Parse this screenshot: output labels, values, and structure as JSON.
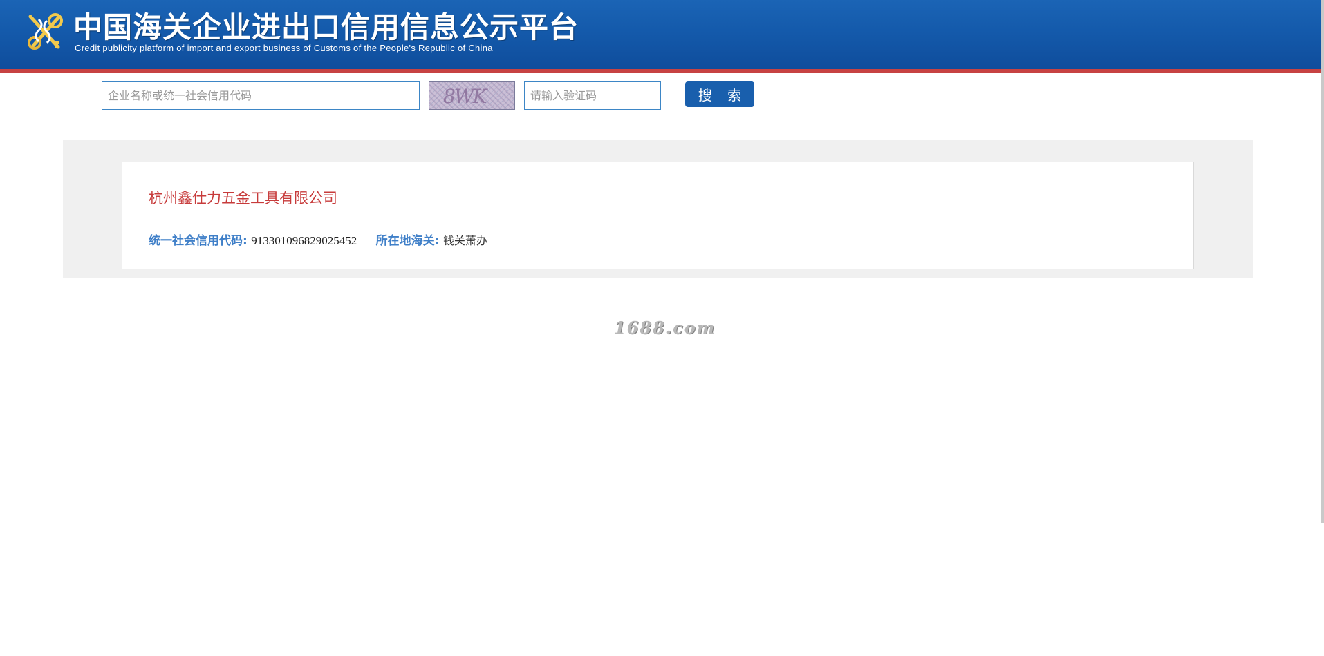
{
  "header": {
    "title_cn": "中国海关企业进出口信用信息公示平台",
    "title_en": "Credit publicity platform of import and export business of Customs of the People's Republic of China",
    "logo_icon": "customs-emblem-icon",
    "brand_color": "#145aab",
    "accent_color": "#c74242"
  },
  "search": {
    "query_placeholder": "企业名称或统一社会信用代码",
    "query_value": "",
    "captcha_text": "8WK",
    "captcha_placeholder": "请输入验证码",
    "captcha_value": "",
    "button_label": "搜 索",
    "button_color": "#195fad"
  },
  "results": [
    {
      "company_name": "杭州鑫仕力五金工具有限公司",
      "credit_code_label": "统一社会信用代码:",
      "credit_code": "913301096829025452",
      "customs_label": "所在地海关:",
      "customs": "钱关萧办"
    }
  ],
  "watermark": "1688.com"
}
